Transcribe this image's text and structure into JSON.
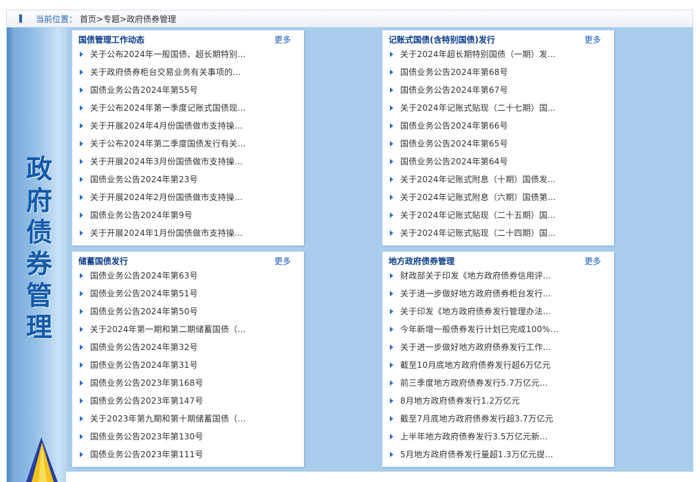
{
  "breadcrumb": {
    "label": "当前位置：",
    "home": "首页",
    "sep1": ">",
    "topic": "专题",
    "sep2": ">",
    "current": "政府债券管理"
  },
  "sidebar": {
    "title_chars": [
      "政",
      "府",
      "债",
      "券",
      "管",
      "理"
    ]
  },
  "panels": [
    {
      "title": "国债管理工作动态",
      "more": "更多",
      "items": [
        "关于公布2024年一般国债、超长期特别…",
        "关于政府债券柜台交易业务有关事项的…",
        "国债业务公告2024年第55号",
        "关于公布2024年第一季度记账式国债现…",
        "关于开展2024年4月份国债做市支持操…",
        "关于公布2024年第二季度国债发行有关…",
        "关于开展2024年3月份国债做市支持操…",
        "国债业务公告2024年第23号",
        "关于开展2024年2月份国债做市支持操…",
        "国债业务公告2024年第9号",
        "关于开展2024年1月份国债做市支持操…"
      ]
    },
    {
      "title": "记账式国债(含特别国债)发行",
      "more": "更多",
      "items": [
        "关于2024年超长期特别国债（一期）发…",
        "国债业务公告2024年第68号",
        "国债业务公告2024年第67号",
        "关于2024年记账式贴现（二十七期）国…",
        "国债业务公告2024年第66号",
        "国债业务公告2024年第65号",
        "国债业务公告2024年第64号",
        "关于2024年记账式附息（十期）国债发…",
        "关于2024年记账式附息（六期）国债第…",
        "关于2024年记账式贴现（二十五期）国…",
        "关于2024年记账式贴现（二十四期）国…"
      ]
    },
    {
      "title": "储蓄国债发行",
      "more": "更多",
      "items": [
        "国债业务公告2024年第63号",
        "国债业务公告2024年第51号",
        "国债业务公告2024年第50号",
        "关于2024年第一期和第二期储蓄国债（…",
        "国债业务公告2024年第32号",
        "国债业务公告2024年第31号",
        "国债业务公告2023年第168号",
        "国债业务公告2023年第147号",
        "关于2023年第九期和第十期储蓄国债（…",
        "国债业务公告2023年第130号",
        "国债业务公告2023年第111号"
      ]
    },
    {
      "title": "地方政府债券管理",
      "more": "更多",
      "items": [
        "财政部关于印发《地方政府债券信用评…",
        "关于进一步做好地方政府债券柜台发行…",
        "关于印发《地方政府债券发行管理办法…",
        "今年新增一般债券发行计划已完成100%…",
        "关于进一步做好地方政府债券发行工作…",
        "截至10月底地方政府债券发行超6万亿元",
        "前三季度地方政府债券发行5.7万亿元…",
        "8月地方政府债券发行1.2万亿元",
        "截至7月底地方政府债券发行超3.7万亿元",
        "上半年地方政府债券发行3.5万亿元新…",
        "5月地方政府债券发行量超1.3万亿元提…"
      ]
    }
  ]
}
